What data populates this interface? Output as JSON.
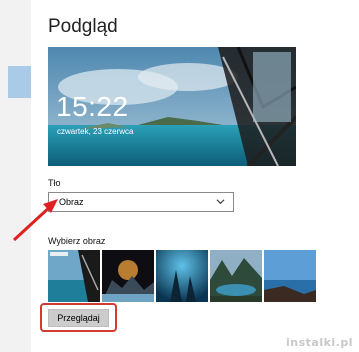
{
  "page": {
    "title": "Podgląd"
  },
  "lock_preview": {
    "time": "15:22",
    "date": "czwartek, 23 czerwca"
  },
  "background": {
    "label": "Tło",
    "selected": "Obraz"
  },
  "picture_picker": {
    "label": "Wybierz obraz",
    "thumbnails": [
      "thumbnail-1",
      "thumbnail-2",
      "thumbnail-3",
      "thumbnail-4",
      "thumbnail-5"
    ]
  },
  "browse_button": {
    "label": "Przeglądaj"
  },
  "watermark": {
    "text": "instalki.pl"
  },
  "colors": {
    "accent_strip": "#a9cbe8",
    "highlight": "#d23a36",
    "arrow": "#e02020"
  }
}
